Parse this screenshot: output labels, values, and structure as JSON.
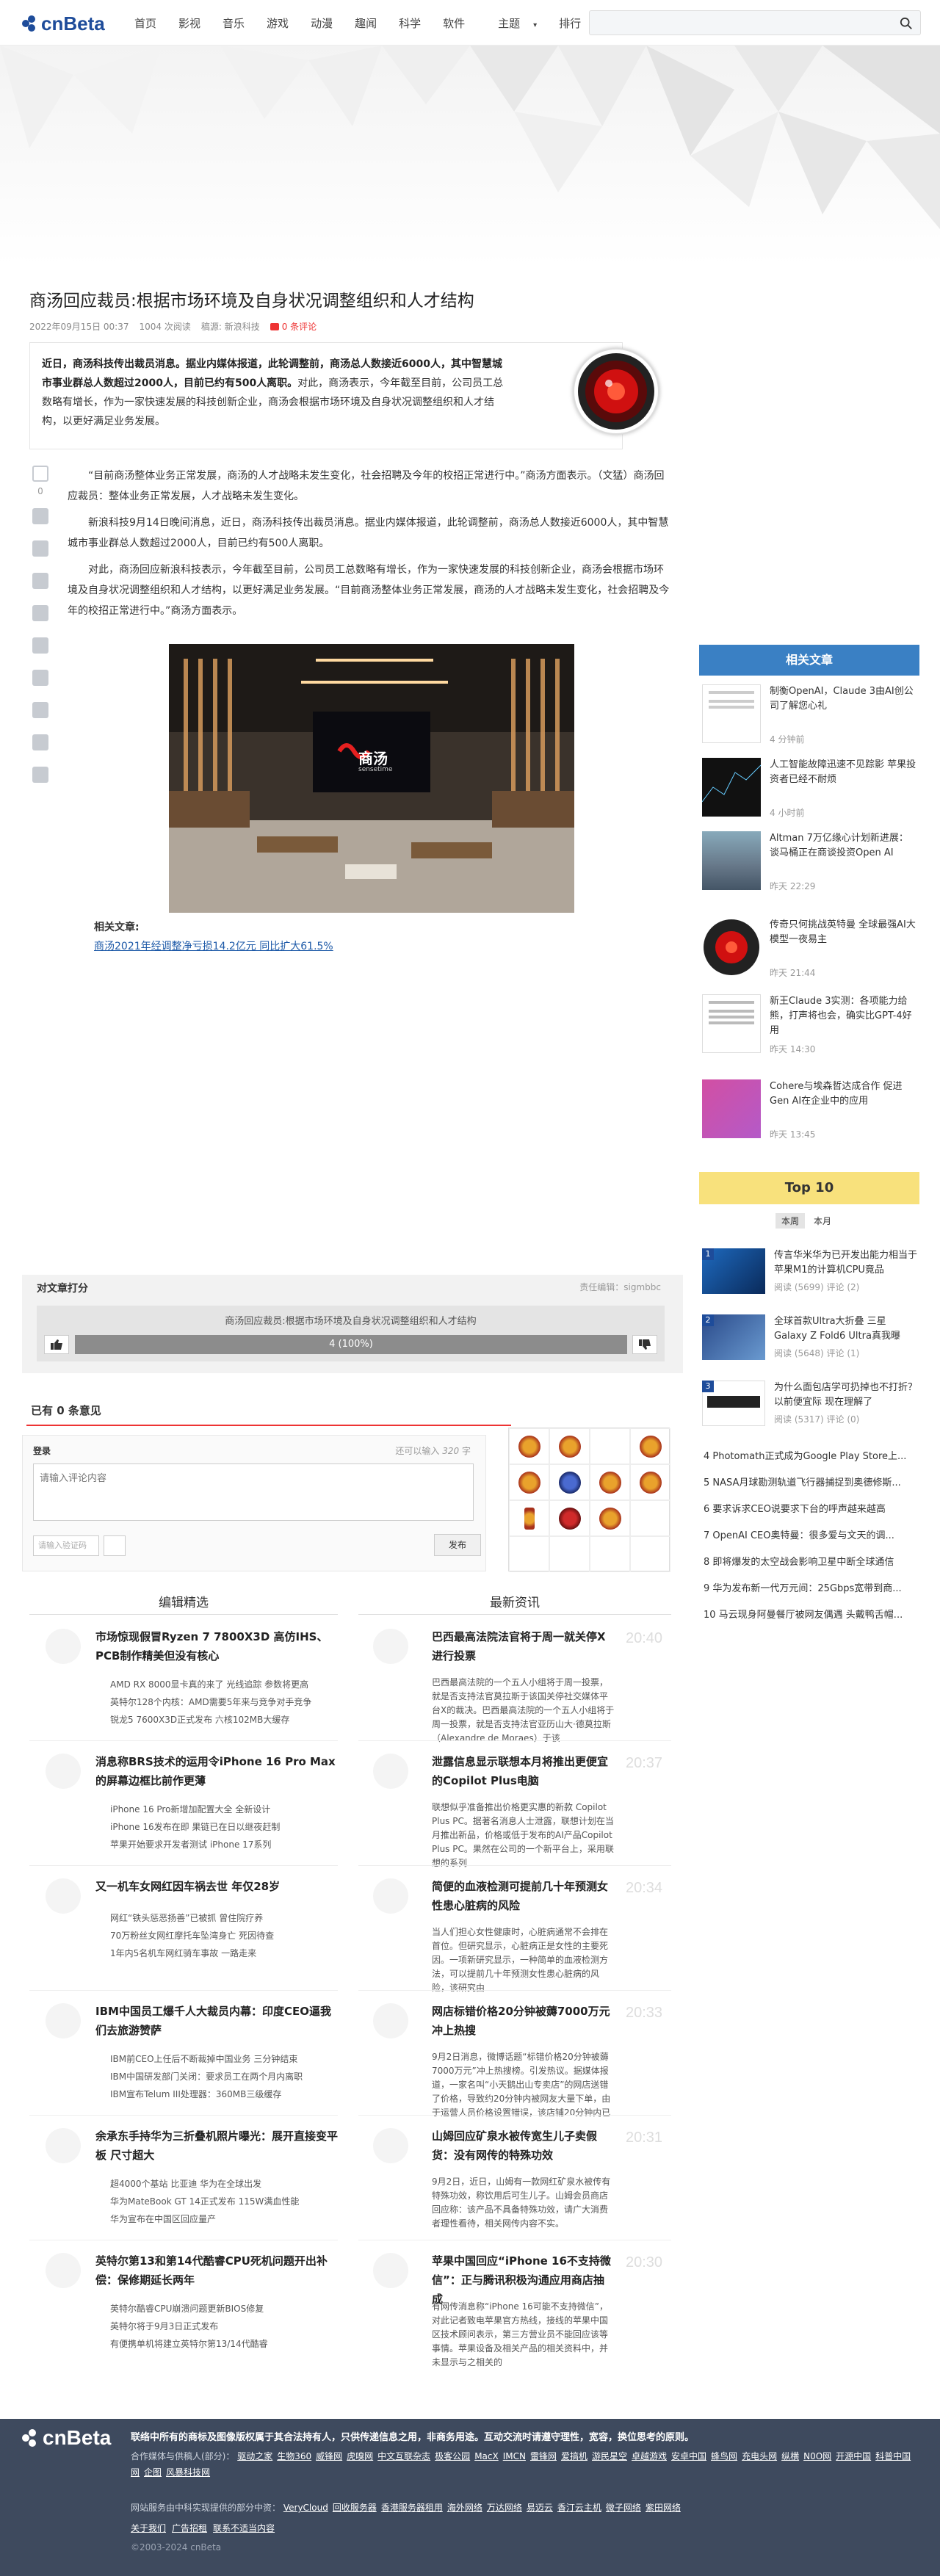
{
  "header": {
    "logo_text": "cnBeta",
    "nav": [
      "首页",
      "影视",
      "音乐",
      "游戏",
      "动漫",
      "趣闻",
      "科学",
      "软件",
      "主题",
      "排行"
    ],
    "search_placeholder": ""
  },
  "article": {
    "title": "商汤回应裁员:根据市场环境及自身状况调整组织和人才结构",
    "date": "2022年09月15日 00:37",
    "views": "1004 次阅读",
    "source_label": "稿源:",
    "source": "新浪科技",
    "comments": "0 条评论",
    "summary_bold": "近日，商汤科技传出裁员消息。据业内媒体报道，此轮调整前，商汤总人数接近6000人，其中智慧城市事业群总人数超过2000人，目前已约有500人离职。",
    "summary_rest": "对此，商汤表示，今年截至目前，公司员工总数略有增长，作为一家快速发展的科技创新企业，商汤会根据市场环境及自身状况调整组织和人才结构，以更好满足业务发展。",
    "like_count": "0",
    "paragraphs": [
      "“目前商汤整体业务正常发展，商汤的人才战略未发生变化，社会招聘及今年的校招正常进行中。”商汤方面表示。（文猛）商汤回应裁员：整体业务正常发展，人才战略未发生变化。",
      "新浪科技9月14日晚间消息，近日，商汤科技传出裁员消息。据业内媒体报道，此轮调整前，商汤总人数接近6000人，其中智慧城市事业群总人数超过2000人，目前已约有500人离职。",
      "对此，商汤回应新浪科技表示，今年截至目前，公司员工总数略有增长，作为一家快速发展的科技创新企业，商汤会根据市场环境及自身状况调整组织和人才结构，以更好满足业务发展。“目前商汤整体业务正常发展，商汤的人才战略未发生变化，社会招聘及今年的校招正常进行中。”商汤方面表示。"
    ],
    "photo_logo_cn": "商汤",
    "photo_logo_en": "sensetime",
    "related_label": "相关文章:",
    "related_link": "商汤2021年经调整净亏损14.2亿元 同比扩大61.5%"
  },
  "sidebar": {
    "related_title": "相关文章",
    "related": [
      {
        "title": "制衡OpenAI，Claude 3由AI创公司了解您心礼",
        "time": "4 分钟前"
      },
      {
        "title": "人工智能故障迅速不见踪影 苹果投资者已经不耐烦",
        "time": "4 小时前"
      },
      {
        "title": "Altman 7万亿缘心计划新进展：谈马桶正在商谈投资Open AI",
        "time": "昨天 22:29"
      },
      {
        "title": "传奇只何挑战英特曼 全球最强AI大模型一夜易主",
        "time": "昨天 21:44"
      },
      {
        "title": "新王Claude 3实测：各项能力给熊，打声将也会，确实比GPT-4好用",
        "time": "昨天 14:30"
      },
      {
        "title": "Cohere与埃森哲达成合作 促进Gen AI在企业中的应用",
        "time": "昨天 13:45"
      }
    ],
    "top_title": "Top 10",
    "top_tabs": [
      "本周",
      "本月"
    ],
    "top_items": [
      {
        "num": "1",
        "title": "传言华米华为已开发出能力相当于苹果M1的计算机CPU竟品",
        "meta": "阅读 (5699) 评论 (2)"
      },
      {
        "num": "2",
        "title": "全球首款Ultra大折叠 三星Galaxy Z Fold6 Ultra真我曝",
        "meta": "阅读 (5648) 评论 (1)"
      },
      {
        "num": "3",
        "title": "为什么面包店学可扔掉也不打折？以前便宜际 现在理解了",
        "meta": "阅读 (5317) 评论 (0)"
      }
    ],
    "top_lines": [
      "4 Photomath正式成为Google Play Store上...",
      "5 NASA月球勘测轨道飞行器捕捉到奥德修斯...",
      "6 要求诉求CEO说要求下台的呼声越来越高",
      "7 OpenAI CEO奥特曼：很多爱与文天的调...",
      "8 即将爆发的太空战会影响卫星中断全球通信",
      "9 华为发布新一代万元间：25Gbps宽带到商...",
      "10 马云现身阿曼餐厅被网友偶遇 头戴鸭舌帽..."
    ]
  },
  "rating": {
    "title": "对文章打分",
    "editor": "责任编辑：sigmbbc",
    "question": "商汤回应裁员:根据市场环境及自身状况调整组织和人才结构",
    "bar_label": "4 (100%)",
    "percent": 100
  },
  "comments": {
    "count_label": "已有 0 条意见",
    "login": "登录",
    "remaining_pre": "还可以输入",
    "remaining_num": "320",
    "remaining_post": "字",
    "placeholder": "请输入评论内容",
    "verify_placeholder": "请输入验证码",
    "submit": "发布"
  },
  "picks": {
    "title": "编辑精选",
    "items": [
      {
        "title": "市场惊现假冒Ryzen 7 7800X3D 高仿IHS、PCB制作精美但没有核心",
        "bullets": [
          "AMD RX 8000显卡真的来了 光线追踪 参数将更高",
          "英特尔128个内核：AMD需要5年来与竞争对手竞争",
          "锐龙5 7600X3D正式发布 六核102MB大缓存"
        ]
      },
      {
        "title": "消息称BRS技术的运用令iPhone 16 Pro Max的屏幕边框比前作更薄",
        "bullets": [
          "iPhone 16 Pro新增加配置大全 全新设计",
          "iPhone 16发布在即 果链已在日以继夜赶制",
          "苹果开始要求开发者测试 iPhone 17系列"
        ]
      },
      {
        "title": "又一机车女网红因车祸去世 年仅28岁",
        "bullets": [
          "网红“铁头惩恶扬善”已被抓 曾住院疗养",
          "70万粉丝女网红摩托车坠湾身亡 死因待查",
          "1年内5名机车网红骑车事故 一路走来"
        ]
      },
      {
        "title": "IBM中国员工爆千人大裁员内幕：印度CEO逼我们去旅游赞萨",
        "bullets": [
          "IBM前CEO上任后不断裁掉中国业务 三分钟结束",
          "IBM中国研发部门关闭：要求员工在两个月内离职",
          "IBM宣布Telum III处理器：360MB三级缓存"
        ]
      },
      {
        "title": "余承东手持华为三折叠机照片曝光：展开直接变平板 尺寸超大",
        "bullets": [
          "超4000个基站 比亚迪 华为在全球出发",
          "华为MateBook GT 14正式发布 115W满血性能",
          "华为宣布在中国区回应量产"
        ]
      },
      {
        "title": "英特尔第13和第14代酷睿CPU死机问题开出补偿：保修期延长两年",
        "bullets": [
          "英特尔酷睿CPU崩溃问题更新BIOS修复",
          "英特尔将于9月3日正式发布",
          "有便携单机将建立英特尔第13/14代酷睿"
        ]
      }
    ]
  },
  "latest": {
    "title": "最新资讯",
    "items": [
      {
        "title": "巴西最高法院法官将于周一就关停X进行投票",
        "time": "20:40",
        "desc": "巴西最高法院的一个五人小组将于周一投票，就是否支持法官莫拉斯于该国关停社交媒体平台X的裁决。巴西最高法院的一个五人小组将于周一投票，就是否支持法官亚历山大·德莫拉斯（Alexandre de Moraes）于该"
      },
      {
        "title": "泄露信息显示联想本月将推出更便宜的Copilot Plus电脑",
        "time": "20:37",
        "desc": "联想似乎准备推出价格更实惠的新款 Copilot Plus PC。据著名消息人士泄露，联想计划在当月推出新品，价格或低于发布的AI产品Copilot Plus PC。果然在公司的一个新平台上，采用联想的系列"
      },
      {
        "title": "简便的血液检测可提前几十年预测女性患心脏病的风险",
        "time": "20:34",
        "desc": "当人们担心女性健康时，心脏病通常不会排在首位。但研究显示，心脏病正是女性的主要死因。一项新研究显示，一种简单的血液检测方法，可以提前几十年预测女性患心脏病的风险，该研究由"
      },
      {
        "title": "网店标错价格20分钟被薅7000万元冲上热搜",
        "time": "20:33",
        "desc": "9月2日消息，微博话题“标错价格20分钟被薅7000万元”冲上热搜榜。引发热议。据媒体报道，一家名叫“小天鹅出山专卖店”的网店送错了价格，导致约20分钟内被网友大量下单，由于运营人员价格设置错误，该店铺20分钟内已达到"
      },
      {
        "title": "山姆回应矿泉水被传宽生儿子卖假货：没有网传的特殊功效",
        "time": "20:31",
        "desc": "9月2日，近日，山姆有一款网红矿泉水被传有特殊功效，称饮用后可生儿子。山姆会员商店回应称：该产品不具备特殊功效，请广大消费者理性看待，相关网传内容不实。"
      },
      {
        "title": "苹果中国回应“iPhone 16不支持微信”：正与腾讯积极沟通应用商店抽成",
        "time": "20:30",
        "desc": "有网传消息称“iPhone 16可能不支持微信”，对此记者致电苹果官方热线，接线的苹果中国区技术顾问表示，第三方营业员不能回应该等事情。苹果设备及相关产品的相关资料中，并未显示与之相关的"
      }
    ]
  },
  "footer": {
    "logo_text": "cnBeta",
    "statement": "联络中所有的商标及图像版权属于其合法持有人，只供传递信息之用，非商务用途。互动交流时请遵守理性，宽容，换位思考的原则。",
    "partners_label": "合作媒体与供稿人(部分)：",
    "partners": [
      "驱动之家",
      "生物360",
      "威锋网",
      "虎嗅网",
      "中文互联杂志",
      "极客公园",
      "MacX",
      "IMCN",
      "雷锋网",
      "爱搞机",
      "游民星空",
      "卓越游戏",
      "安卓中国",
      "蜂鸟网",
      "充电头网",
      "纵横",
      "N0O网",
      "开源中国",
      "科普中国网",
      "企图",
      "风暴科技网"
    ],
    "cdn_label": "网站服务由中科实现提供的部分中资：",
    "cdn": [
      "VeryCloud",
      "回收服务器",
      "香港服务器租用",
      "海外网络",
      "万达网络",
      "易迈云",
      "香汀云主机",
      "微子网络",
      "紫田网络"
    ],
    "links": [
      "关于我们",
      "广告招租",
      "联系不适当内容"
    ],
    "copyright": "©2003-2024 cnBeta"
  }
}
